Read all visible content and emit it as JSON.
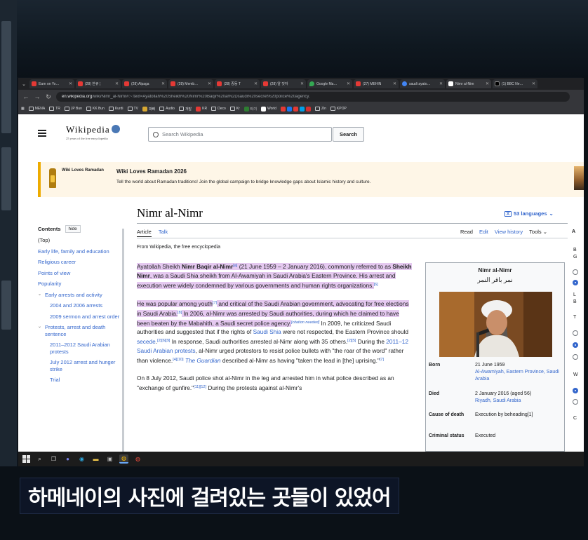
{
  "browser": {
    "tabs": [
      {
        "title": "Earn on Yo…",
        "icon": "youtube-icon"
      },
      {
        "title": "(28) 한큐 ¦",
        "icon": "youtube-icon"
      },
      {
        "title": "(28) Alpaga",
        "icon": "youtube-icon"
      },
      {
        "title": "(28) Memb…",
        "icon": "youtube-icon"
      },
      {
        "title": "(28) 중동 T",
        "icon": "youtube-icon"
      },
      {
        "title": "(28) 알 짓자",
        "icon": "youtube-icon"
      },
      {
        "title": "Google Ma…",
        "icon": "google-maps-icon"
      },
      {
        "title": "(27) MEHIN",
        "icon": "youtube-icon"
      },
      {
        "title": "saudi ayato…",
        "icon": "google-icon"
      },
      {
        "title": "Nimr al-Nim",
        "icon": "wikipedia-icon"
      },
      {
        "title": "(1) BBC Ne…",
        "icon": "x-icon"
      }
    ],
    "url_host": "en.wikipedia.org",
    "url_rest": "/wiki/Nimr_al-Nimr#:~:text=Ayatollah%20Sheikh%20Nimr%20Baqir%20al%2Dsaudi%20secret%20police%20agency.",
    "bookmarks": [
      "MENA",
      "TR",
      "JP Bun",
      "KK Bun",
      "Kurdi",
      "TV",
      "파삐",
      "Audio",
      "개발",
      "KR",
      "Deco",
      "Kr",
      "타기",
      "World",
      "Zin",
      "KPOP"
    ]
  },
  "wiki": {
    "logo_wordmark": "Wikipedia",
    "logo_tagline": "25 years of the free encyclopedia",
    "search_placeholder": "Search Wikipedia",
    "search_button": "Search",
    "banner": {
      "logo_text": "Wiki Loves Ramadan",
      "title": "Wiki Loves Ramadan 2026",
      "description": "Tell the world about Ramadan traditions! Join the global campaign to bridge knowledge gaps about Islamic history and culture."
    },
    "title": "Nimr al-Nimr",
    "languages": "53 languages",
    "tabs_left": [
      "Article",
      "Talk"
    ],
    "tabs_right": [
      "Read",
      "Edit",
      "View history",
      "Tools"
    ],
    "from_line": "From Wikipedia, the free encyclopedia",
    "toc": {
      "heading": "Contents",
      "hide": "hide",
      "top": "(Top)",
      "items": [
        "Early life, family and education",
        "Religious career",
        "Points of view",
        "Popularity",
        "Early arrests and activity",
        "2004 and 2006 arrests",
        "2009 sermon and arrest order",
        "Protests, arrest and death sentence",
        "2011–2012 Saudi Arabian protests",
        "July 2012 arrest and hunger strike",
        "Trial"
      ]
    },
    "infobox": {
      "title": "Nimr al-Nimr",
      "native_name": "نمر باقر النمر",
      "rows": [
        {
          "k": "Born",
          "v1": "21 June 1959",
          "v2": "Al-Awamiyah, Eastern Province, Saudi Arabia"
        },
        {
          "k": "Died",
          "v1": "2 January 2016 (aged 56)",
          "v2": "Riyadh, Saudi Arabia"
        },
        {
          "k": "Cause of death",
          "v1": "Execution by beheading[1]"
        },
        {
          "k": "Criminal status",
          "v1": "Executed"
        }
      ]
    },
    "right_col_letters": [
      "A",
      "B",
      "G",
      "L",
      "B",
      "T",
      "W",
      "C"
    ]
  },
  "subtitle": "하메네이의 사진에 걸려있는 곳들이 있었어"
}
